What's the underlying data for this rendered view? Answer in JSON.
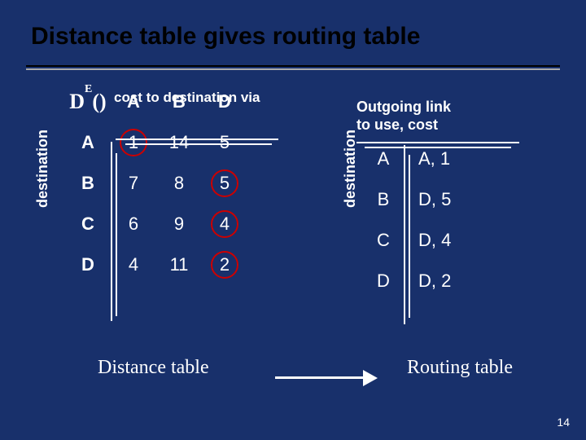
{
  "title": "Distance table gives routing table",
  "distance_table": {
    "subtitle": "cost to destination via",
    "symbol_base": "D",
    "symbol_sup": "E",
    "symbol_paren": "()",
    "axis_label": "destination",
    "cols": [
      "A",
      "B",
      "D"
    ],
    "rows": [
      "A",
      "B",
      "C",
      "D"
    ],
    "cells": [
      [
        "1",
        "14",
        "5"
      ],
      [
        "7",
        "8",
        "5"
      ],
      [
        "6",
        "9",
        "4"
      ],
      [
        "4",
        "11",
        "2"
      ]
    ],
    "circled": [
      [
        0,
        0
      ],
      [
        1,
        2
      ],
      [
        2,
        2
      ],
      [
        3,
        2
      ]
    ]
  },
  "routing_table": {
    "header_l1": "Outgoing link",
    "header_l2": "to use, cost",
    "axis_label": "destination",
    "rows": [
      "A",
      "B",
      "C",
      "D"
    ],
    "values": [
      "A, 1",
      "D, 5",
      "D, 4",
      "D, 2"
    ]
  },
  "caption_left": "Distance table",
  "caption_right": "Routing table",
  "page_number": "14",
  "chart_data": {
    "type": "table",
    "title": "Distance table gives routing table",
    "distance_table": {
      "via": [
        "A",
        "B",
        "D"
      ],
      "destinations": [
        "A",
        "B",
        "C",
        "D"
      ],
      "cost": {
        "A": {
          "A": 1,
          "B": 14,
          "D": 5
        },
        "B": {
          "A": 7,
          "B": 8,
          "D": 5
        },
        "C": {
          "A": 6,
          "B": 9,
          "D": 4
        },
        "D": {
          "A": 4,
          "B": 11,
          "D": 2
        }
      },
      "minimum_via": {
        "A": "A",
        "B": "D",
        "C": "D",
        "D": "D"
      }
    },
    "routing_table": {
      "A": {
        "link": "A",
        "cost": 1
      },
      "B": {
        "link": "D",
        "cost": 5
      },
      "C": {
        "link": "D",
        "cost": 4
      },
      "D": {
        "link": "D",
        "cost": 2
      }
    }
  }
}
